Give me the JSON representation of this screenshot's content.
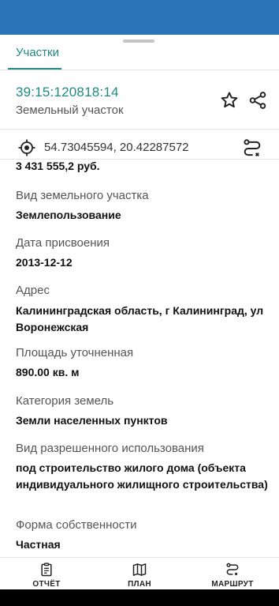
{
  "tabs": {
    "active": "Участки"
  },
  "header": {
    "cadastral_number": "39:15:120818:14",
    "object_type": "Земельный участок"
  },
  "location": {
    "coordinates": "54.73045594, 20.42287572"
  },
  "details": {
    "price": "3 431 555,2 руб.",
    "fields": [
      {
        "label": "Вид земельного участка",
        "value": "Землепользование"
      },
      {
        "label": "Дата присвоения",
        "value": "2013-12-12"
      },
      {
        "label": "Адрес",
        "value": "Калининградская область, г Калининград, ул Воронежская"
      },
      {
        "label": "Площадь уточненная",
        "value": "890.00 кв. м"
      },
      {
        "label": "Категория земель",
        "value": "Земли населенных пунктов"
      },
      {
        "label": "Вид разрешенного использования",
        "value": "под строительство жилого дома (объекта индивидуального жилищного строительства)"
      },
      {
        "label": "Форма собственности",
        "value": "Частная"
      }
    ]
  },
  "bottom_nav": [
    {
      "label": "ОТЧЁТ",
      "icon": "report-icon"
    },
    {
      "label": "ПЛАН",
      "icon": "map-icon"
    },
    {
      "label": "МАРШРУТ",
      "icon": "route-icon"
    }
  ],
  "colors": {
    "accent": "#1f8a86",
    "top_bar": "#2b74b8"
  }
}
